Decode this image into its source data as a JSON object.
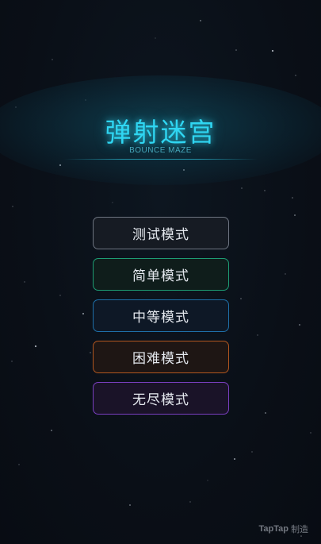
{
  "game": {
    "title": "弹射迷宫",
    "subtitle": "BOUNCE MAZE"
  },
  "menu": {
    "buttons": [
      {
        "label": "测试模式",
        "border_color": "#6d7480"
      },
      {
        "label": "简单模式",
        "border_color": "#1d9c73"
      },
      {
        "label": "中等模式",
        "border_color": "#1e6fa8"
      },
      {
        "label": "困难模式",
        "border_color": "#b0561f"
      },
      {
        "label": "无尽模式",
        "border_color": "#7a3fc0"
      }
    ]
  },
  "watermark": {
    "brand": "TapTap",
    "suffix": "制造"
  },
  "colors": {
    "background": "#0b1018",
    "title": "#2fd6f2",
    "subtitle": "#47a8bc"
  }
}
